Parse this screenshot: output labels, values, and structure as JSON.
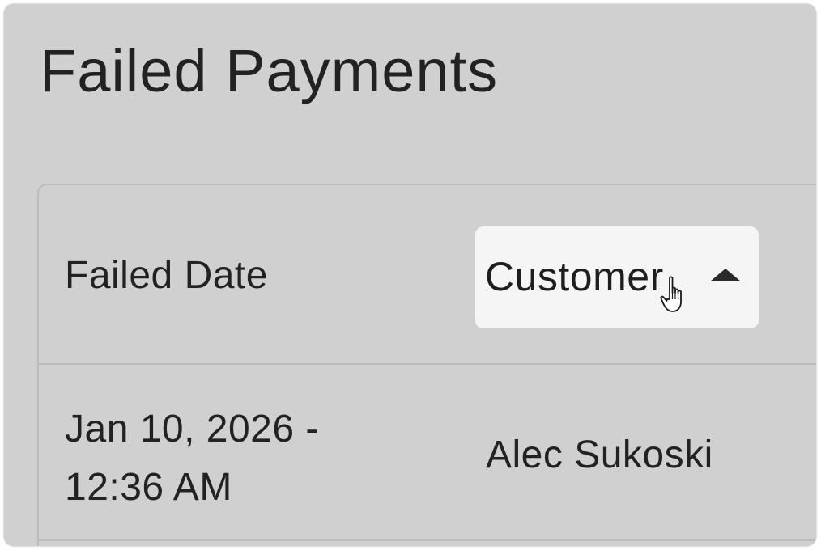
{
  "page": {
    "title": "Failed Payments"
  },
  "table": {
    "columns": {
      "failed_date": "Failed Date",
      "customer": "Customer"
    },
    "sort": {
      "column": "Customer",
      "direction": "ascending",
      "icon": "caret-up-icon"
    },
    "rows": [
      {
        "failed_date_line1": "Jan 10, 2026 -",
        "failed_date_line2": "12:36 AM",
        "customer": "Alec Sukoski"
      }
    ]
  },
  "cursor": {
    "icon": "hand-pointer-icon"
  },
  "colors": {
    "background": "#d0d0d0",
    "sort_button_bg": "#f5f5f5",
    "text": "#222222",
    "divider": "#bcbcbc"
  }
}
